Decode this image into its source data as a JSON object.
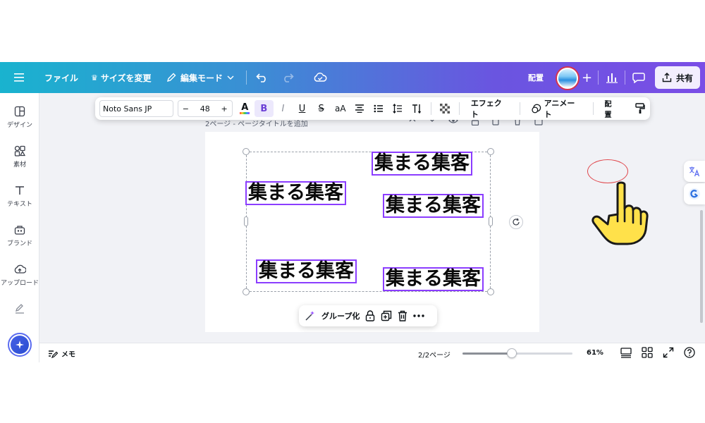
{
  "topbar": {
    "file": "ファイル",
    "resize": "サイズを変更",
    "edit_mode": "編集モード",
    "arrange": "配置",
    "share": "共有",
    "plus": "+"
  },
  "sidebar": {
    "items": [
      {
        "label": "デザイン",
        "icon": "layout-icon"
      },
      {
        "label": "素材",
        "icon": "elements-icon"
      },
      {
        "label": "テキスト",
        "icon": "text-icon"
      },
      {
        "label": "ブランド",
        "icon": "brand-icon"
      },
      {
        "label": "アップロード",
        "icon": "upload-icon"
      }
    ]
  },
  "toolbar": {
    "font": "Noto Sans JP",
    "minus": "−",
    "size": "48",
    "plus": "+",
    "color_letter": "A",
    "bold": "B",
    "italic": "I",
    "underline": "U",
    "strike": "S",
    "case": "aA",
    "effects": "エフェクト",
    "animate": "アニメート",
    "arrange": "配置"
  },
  "page": {
    "title": "2ページ - ページタイトルを追加"
  },
  "text_boxes": [
    "集まる集客",
    "集まる集客",
    "集まる集客",
    "集まる集客",
    "集まる集客"
  ],
  "groupbar": {
    "group": "グループ化"
  },
  "bottombar": {
    "memo": "メモ",
    "page_indicator": "2/2ページ",
    "zoom": "61%",
    "zoom_fraction": 0.45
  },
  "colors": {
    "brand_gradient_start": "#19b3cf",
    "brand_gradient_end": "#7a4ee6",
    "selection": "#8b3dff",
    "annotation": "#e0474c",
    "hand": "#ffe14a"
  }
}
